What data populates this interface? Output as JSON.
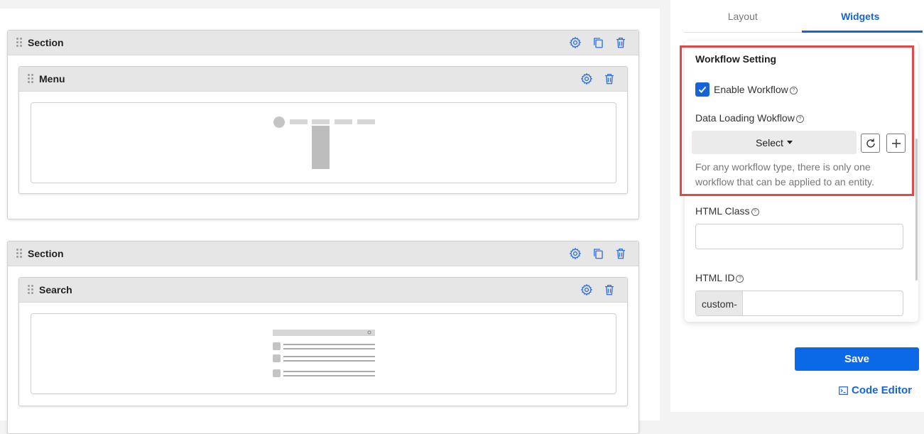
{
  "canvas": {
    "sections": [
      {
        "title": "Section",
        "widget": {
          "title": "Menu",
          "preview": "menu-preview"
        }
      },
      {
        "title": "Section",
        "widget": {
          "title": "Search",
          "preview": "search-preview"
        }
      }
    ]
  },
  "panel": {
    "tabs": [
      {
        "label": "Layout",
        "active": false
      },
      {
        "label": "Widgets",
        "active": true
      }
    ],
    "workflow": {
      "heading": "Workflow Setting",
      "enable_label": "Enable Workflow",
      "enable_checked": true,
      "data_loading_label": "Data Loading Wokflow",
      "select_value": "Select",
      "hint": "For any workflow type, there is only one workflow that can be applied to an entity."
    },
    "html_class": {
      "label": "HTML Class",
      "value": ""
    },
    "html_id": {
      "label": "HTML ID",
      "prefix": "custom-",
      "value": ""
    },
    "save_label": "Save",
    "code_editor_label": "Code Editor"
  },
  "colors": {
    "accent": "#1565d8",
    "save_button": "#0b68e6",
    "highlight_border": "#e34848",
    "header_bg": "#e6e6e6"
  },
  "icons": [
    "drag-handle-icon",
    "gear-icon",
    "copy-icon",
    "trash-icon",
    "help-icon",
    "check-icon",
    "refresh-icon",
    "plus-icon",
    "code-editor-icon"
  ]
}
